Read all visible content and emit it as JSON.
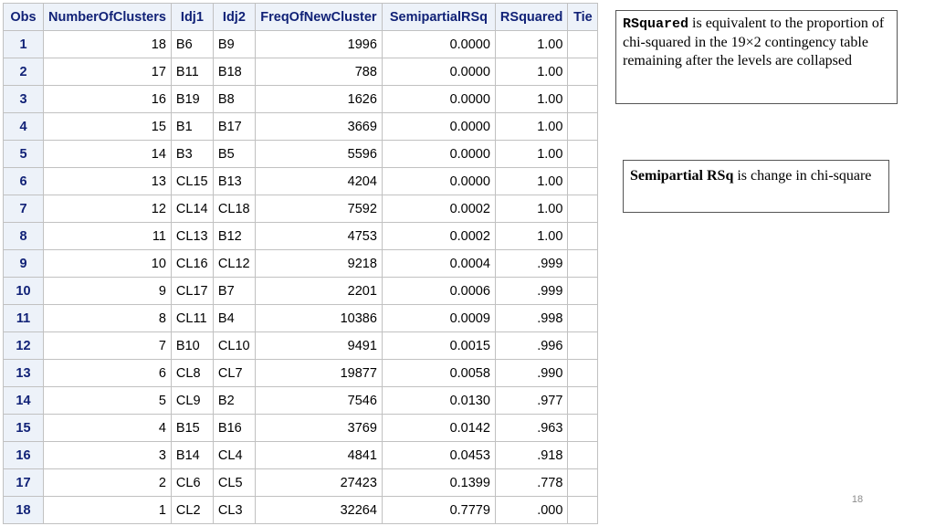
{
  "table": {
    "headers": {
      "obs": "Obs",
      "clusters": "NumberOfClusters",
      "idj1": "Idj1",
      "idj2": "Idj2",
      "freq": "FreqOfNewCluster",
      "semipartial": "SemipartialRSq",
      "rsquared": "RSquared",
      "tie": "Tie"
    },
    "rows": [
      {
        "obs": "1",
        "clusters": "18",
        "idj1": "B6",
        "idj2": "B9",
        "freq": "1996",
        "semipartial": "0.0000",
        "rsquared": "1.00",
        "tie": ""
      },
      {
        "obs": "2",
        "clusters": "17",
        "idj1": "B11",
        "idj2": "B18",
        "freq": "788",
        "semipartial": "0.0000",
        "rsquared": "1.00",
        "tie": ""
      },
      {
        "obs": "3",
        "clusters": "16",
        "idj1": "B19",
        "idj2": "B8",
        "freq": "1626",
        "semipartial": "0.0000",
        "rsquared": "1.00",
        "tie": ""
      },
      {
        "obs": "4",
        "clusters": "15",
        "idj1": "B1",
        "idj2": "B17",
        "freq": "3669",
        "semipartial": "0.0000",
        "rsquared": "1.00",
        "tie": ""
      },
      {
        "obs": "5",
        "clusters": "14",
        "idj1": "B3",
        "idj2": "B5",
        "freq": "5596",
        "semipartial": "0.0000",
        "rsquared": "1.00",
        "tie": ""
      },
      {
        "obs": "6",
        "clusters": "13",
        "idj1": "CL15",
        "idj2": "B13",
        "freq": "4204",
        "semipartial": "0.0000",
        "rsquared": "1.00",
        "tie": ""
      },
      {
        "obs": "7",
        "clusters": "12",
        "idj1": "CL14",
        "idj2": "CL18",
        "freq": "7592",
        "semipartial": "0.0002",
        "rsquared": "1.00",
        "tie": ""
      },
      {
        "obs": "8",
        "clusters": "11",
        "idj1": "CL13",
        "idj2": "B12",
        "freq": "4753",
        "semipartial": "0.0002",
        "rsquared": "1.00",
        "tie": ""
      },
      {
        "obs": "9",
        "clusters": "10",
        "idj1": "CL16",
        "idj2": "CL12",
        "freq": "9218",
        "semipartial": "0.0004",
        "rsquared": ".999",
        "tie": ""
      },
      {
        "obs": "10",
        "clusters": "9",
        "idj1": "CL17",
        "idj2": "B7",
        "freq": "2201",
        "semipartial": "0.0006",
        "rsquared": ".999",
        "tie": ""
      },
      {
        "obs": "11",
        "clusters": "8",
        "idj1": "CL11",
        "idj2": "B4",
        "freq": "10386",
        "semipartial": "0.0009",
        "rsquared": ".998",
        "tie": ""
      },
      {
        "obs": "12",
        "clusters": "7",
        "idj1": "B10",
        "idj2": "CL10",
        "freq": "9491",
        "semipartial": "0.0015",
        "rsquared": ".996",
        "tie": ""
      },
      {
        "obs": "13",
        "clusters": "6",
        "idj1": "CL8",
        "idj2": "CL7",
        "freq": "19877",
        "semipartial": "0.0058",
        "rsquared": ".990",
        "tie": ""
      },
      {
        "obs": "14",
        "clusters": "5",
        "idj1": "CL9",
        "idj2": "B2",
        "freq": "7546",
        "semipartial": "0.0130",
        "rsquared": ".977",
        "tie": ""
      },
      {
        "obs": "15",
        "clusters": "4",
        "idj1": "B15",
        "idj2": "B16",
        "freq": "3769",
        "semipartial": "0.0142",
        "rsquared": ".963",
        "tie": ""
      },
      {
        "obs": "16",
        "clusters": "3",
        "idj1": "B14",
        "idj2": "CL4",
        "freq": "4841",
        "semipartial": "0.0453",
        "rsquared": ".918",
        "tie": ""
      },
      {
        "obs": "17",
        "clusters": "2",
        "idj1": "CL6",
        "idj2": "CL5",
        "freq": "27423",
        "semipartial": "0.1399",
        "rsquared": ".778",
        "tie": ""
      },
      {
        "obs": "18",
        "clusters": "1",
        "idj1": "CL2",
        "idj2": "CL3",
        "freq": "32264",
        "semipartial": "0.7779",
        "rsquared": ".000",
        "tie": ""
      }
    ]
  },
  "notes": {
    "rsquared": {
      "term": "RSquared",
      "text": " is equivalent to the proportion of chi-squared in the 19×2 contingency table remaining after the levels are collapsed"
    },
    "semipartial": {
      "term": "Semipartial RSq",
      "text": " is change in chi-square"
    }
  },
  "page_number": "18",
  "colors": {
    "header_bg": "#edf2f9",
    "header_text": "#112277",
    "grid": "#c1c1c1"
  }
}
